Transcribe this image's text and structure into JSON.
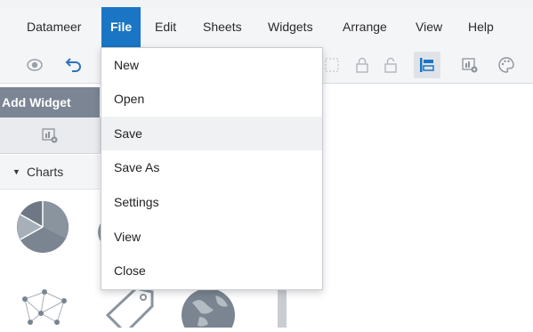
{
  "menubar": {
    "items": [
      {
        "label": "Datameer"
      },
      {
        "label": "File",
        "active": true
      },
      {
        "label": "Edit"
      },
      {
        "label": "Sheets"
      },
      {
        "label": "Widgets"
      },
      {
        "label": "Arrange"
      },
      {
        "label": "View"
      },
      {
        "label": "Help"
      }
    ],
    "active_color": "#1a75c4"
  },
  "toolbar": {
    "icons": [
      "eye-icon",
      "undo-icon",
      "grid-icon",
      "lock-icon",
      "unlock-icon",
      "align-left-icon",
      "widget-settings-icon",
      "palette-icon"
    ]
  },
  "file_menu": {
    "items": [
      {
        "label": "New"
      },
      {
        "label": "Open"
      },
      {
        "label": "Save",
        "highlighted": true
      },
      {
        "label": "Save As"
      },
      {
        "label": "Settings"
      },
      {
        "label": "View"
      },
      {
        "label": "Close"
      }
    ]
  },
  "left_panel": {
    "add_widget_label": "Add Widget",
    "section_label": "Charts",
    "thumbnails": [
      "pie-chart-icon",
      "network-graph-icon",
      "tag-icon",
      "globe-icon"
    ]
  }
}
